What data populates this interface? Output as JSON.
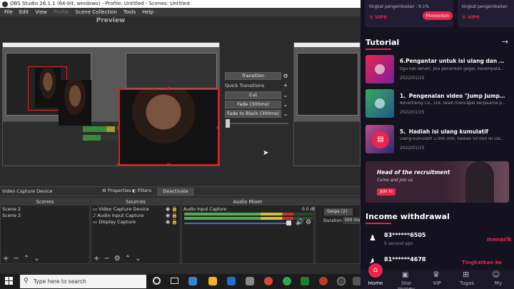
{
  "obs": {
    "title": "OBS Studio 26.1.1 (64-bit, windows) - Profile: Untitled - Scenes: Untitled",
    "menu": [
      "File",
      "Edit",
      "View",
      "Profile",
      "Scene Collection",
      "Tools",
      "Help"
    ],
    "preview_label": "Preview",
    "transitions": {
      "transition_button": "Transition",
      "quick_transitions": "Quick Transitions",
      "cut": "Cut",
      "fade": "Fade (300ms)",
      "fade_black": "Fade to Black (300ms)"
    },
    "source_bar": {
      "source_name": "Video Capture Device",
      "properties": "Properties",
      "filters": "Filters",
      "deactivate": "Deactivate"
    },
    "scenes": {
      "header": "Scenes",
      "items": [
        "Scene 2",
        "Scene 3"
      ]
    },
    "sources": {
      "header": "Sources",
      "items": [
        "Video Capture Device",
        "Audio Input Capture",
        "Display Capture"
      ]
    },
    "audio_mixer": {
      "header": "Audio Mixer",
      "channel": "Audio Input Capture",
      "level": "0.0 dB",
      "meter_fill": 0.85
    },
    "transition_dock": {
      "type": "Swipe (2)",
      "duration_label": "Duration",
      "duration_value": "300 ms"
    }
  },
  "taskbar": {
    "search_placeholder": "Type here to search"
  },
  "phone": {
    "promo": {
      "left_sub": "tingkat pengembalian : 9.1%",
      "left_badge": "VIP8",
      "button": "Menonton",
      "right_sub": "tingkat pengembalian",
      "right_badge": "VIP8"
    },
    "tutorial": {
      "title": "Tutorial",
      "items": [
        {
          "title": "6.Pengantar untuk isi ulang dan pen...",
          "desc": "tiga kali sehari, Jika penarikan gagal, kesempatan p...",
          "date": "2022/01/15"
        },
        {
          "title": "1、Pengenalan video \"Jump Jump\" ...",
          "desc": "Advertising Co., Ltd. telah mencapai kerjasama pro...",
          "date": "2022/01/15"
        },
        {
          "title": "5、Hadiah isi ulang kumulatif",
          "desc": "ulang kumulatif 1.000.000, hadiah 50.000 isi ulang ...",
          "date": "2022/01/15"
        }
      ]
    },
    "recruit": {
      "headline": "Head of the recruitment",
      "sub": "Come and join us",
      "button": "Join in"
    },
    "income": {
      "title": "Income withdrawal",
      "items": [
        {
          "name": "83******6505",
          "time": "9 second ago",
          "tag": "menarik"
        },
        {
          "name": "81******4678",
          "time": "",
          "tag": "Tingkatkan ke"
        }
      ]
    },
    "nav": [
      "Home",
      "Star money",
      "VIP",
      "Tugas",
      "My"
    ]
  },
  "colors": {
    "accent": "#e8254b",
    "obs_bg": "#2b2b2b",
    "selection": "#e02020"
  }
}
